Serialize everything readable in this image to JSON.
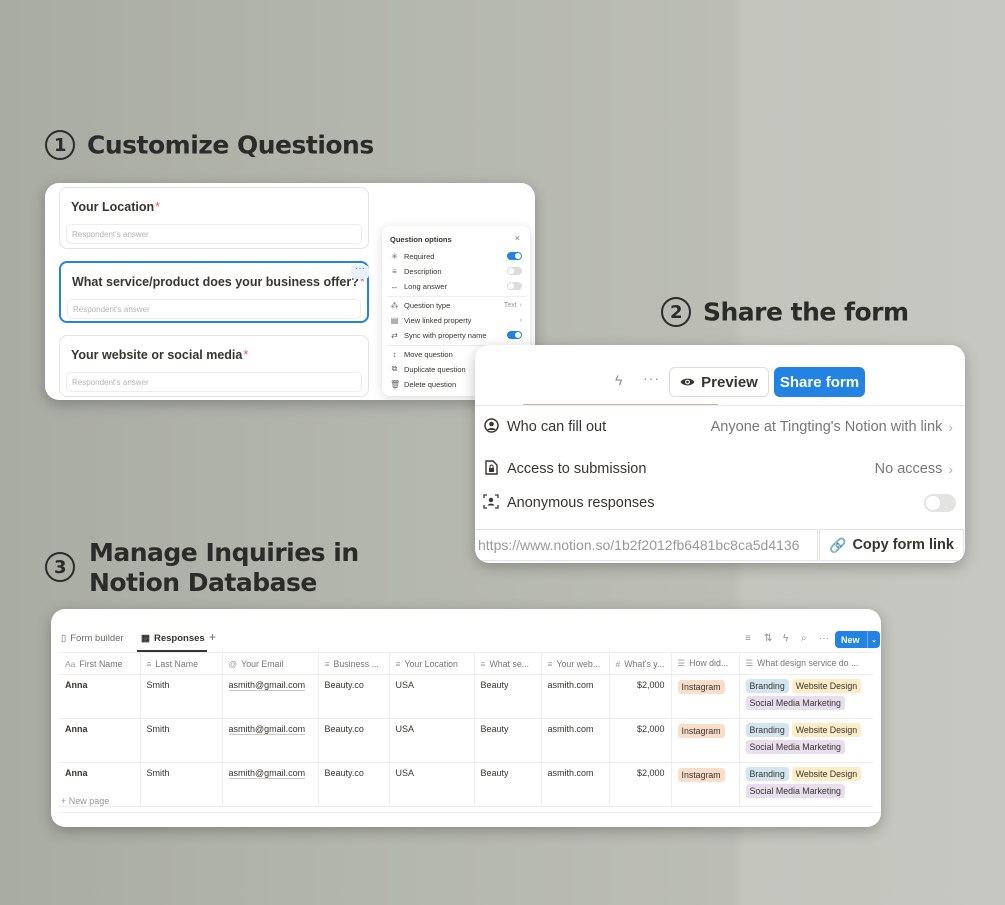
{
  "steps": [
    {
      "number": "1",
      "title": "Customize Questions"
    },
    {
      "number": "2",
      "title": "Share the form"
    },
    {
      "number": "3",
      "title_line1": "Manage Inquiries in",
      "title_line2": "Notion Database"
    }
  ],
  "form_builder": {
    "questions": [
      {
        "title": "Your Location",
        "placeholder": "Respondent's answer"
      },
      {
        "title": "What service/product does your business offer?",
        "placeholder": "Respondent's answer"
      },
      {
        "title": "Your website or social media",
        "placeholder": "Respondent's answer"
      }
    ],
    "required_mark": "*",
    "question_options": {
      "title": "Question options",
      "close": "×",
      "items": [
        {
          "label": "Required",
          "icon": "asterisk-icon",
          "toggle": true
        },
        {
          "label": "Description",
          "icon": "lines-icon",
          "toggle": false
        },
        {
          "label": "Long answer",
          "icon": "arrows-horizontal-icon",
          "toggle": false
        },
        {
          "label": "Question type",
          "icon": "grid-icon",
          "value": "Text"
        },
        {
          "label": "View linked property",
          "icon": "database-icon"
        },
        {
          "label": "Sync with property name",
          "icon": "sync-icon",
          "toggle": true
        },
        {
          "label": "Move question",
          "icon": "move-icon"
        },
        {
          "label": "Duplicate question",
          "icon": "duplicate-icon"
        },
        {
          "label": "Delete question",
          "icon": "trash-icon"
        }
      ]
    }
  },
  "share": {
    "preview_label": "Preview",
    "share_label": "Share form",
    "rows": [
      {
        "label": "Who can fill out",
        "value": "Anyone at Tingting's Notion with link",
        "icon": "person-circle-icon"
      },
      {
        "label": "Access to submission",
        "value": "No access",
        "icon": "file-lock-icon"
      },
      {
        "label": "Anonymous responses",
        "icon": "anonymous-icon",
        "toggle": false
      }
    ],
    "url": "https://www.notion.so/1b2f2012fb6481bc8ca5d4136",
    "copy_label": "Copy form link"
  },
  "database": {
    "tabs": [
      {
        "label": "Form builder",
        "icon": "page-icon"
      },
      {
        "label": "Responses",
        "icon": "table-icon"
      }
    ],
    "add_tab": "+",
    "new_label": "New",
    "columns": [
      {
        "icon": "Aa",
        "label": "First Name"
      },
      {
        "icon": "≡",
        "label": "Last Name"
      },
      {
        "icon": "@",
        "label": "Your Email"
      },
      {
        "icon": "≡",
        "label": "Business ..."
      },
      {
        "icon": "≡",
        "label": "Your Location"
      },
      {
        "icon": "≡",
        "label": "What se..."
      },
      {
        "icon": "≡",
        "label": "Your web..."
      },
      {
        "icon": "#",
        "label": "What's y..."
      },
      {
        "icon": "☰",
        "label": "How did..."
      },
      {
        "icon": "☰",
        "label": "What design service do ..."
      }
    ],
    "rows": [
      {
        "first": "Anna",
        "last": "Smith",
        "email": "asmith@gmail.com",
        "business": "Beauty.co",
        "location": "USA",
        "service": "Beauty",
        "web": "asmith.com",
        "budget": "$2,000",
        "source": "Instagram",
        "design": [
          "Branding",
          "Website Design",
          "Social Media Marketing"
        ]
      },
      {
        "first": "Anna",
        "last": "Smith",
        "email": "asmith@gmail.com",
        "business": "Beauty.co",
        "location": "USA",
        "service": "Beauty",
        "web": "asmith.com",
        "budget": "$2,000",
        "source": "Instagram",
        "design": [
          "Branding",
          "Website Design",
          "Social Media Marketing"
        ]
      },
      {
        "first": "Anna",
        "last": "Smith",
        "email": "asmith@gmail.com",
        "business": "Beauty.co",
        "location": "USA",
        "service": "Beauty",
        "web": "asmith.com",
        "budget": "$2,000",
        "source": "Instagram",
        "design": [
          "Branding",
          "Website Design",
          "Social Media Marketing"
        ]
      }
    ],
    "new_page": "New page"
  },
  "colors": {
    "accent": "#2383e2",
    "tag_orange": "#fadec9",
    "tag_blue": "#d3e5ef",
    "tag_yellow": "#fdecc8",
    "tag_purple": "#e8deee"
  }
}
